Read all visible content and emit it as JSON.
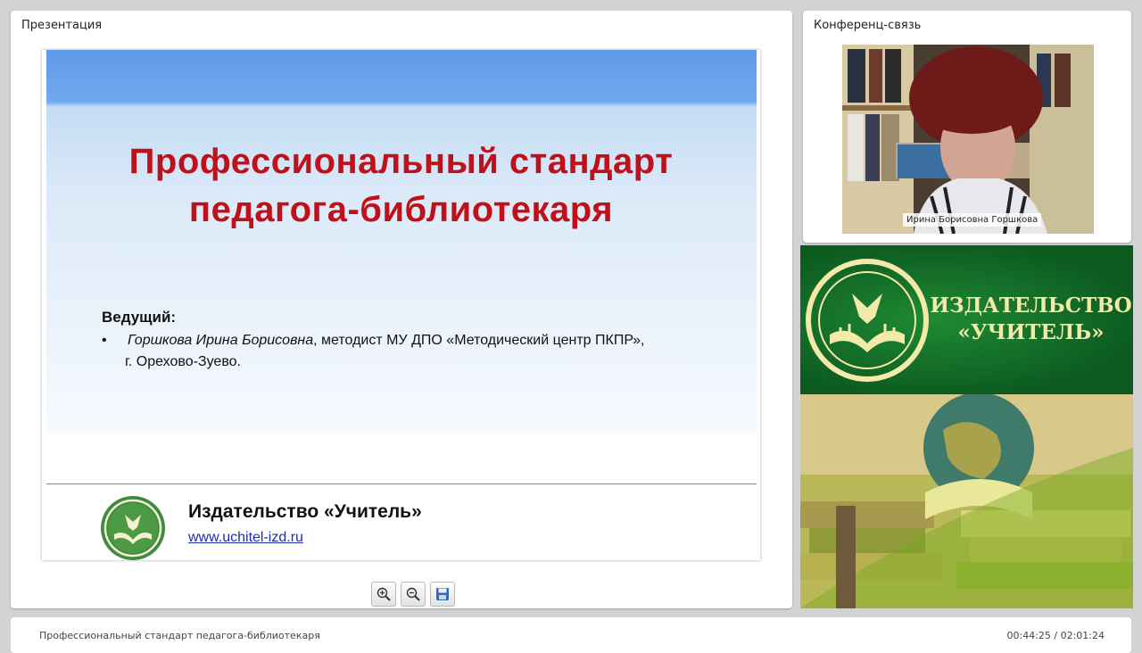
{
  "presentation_panel": {
    "title": "Презентация"
  },
  "conference_panel": {
    "title": "Конференц-связь",
    "speaker_caption": "Ирина Борисовна Горшкова"
  },
  "slide": {
    "title_line1": "Профессиональный стандарт",
    "title_line2": "педагога-библиотекаря",
    "host_label": "Ведущий:",
    "bullet": "•",
    "host_name": "Горшкова Ирина Борисовна",
    "host_desc": ", методист МУ ДПО «Методический центр ПКПР»,",
    "host_city": "г. Орехово-Зуево.",
    "publisher_name": "Издательство «Учитель»",
    "publisher_url": "www.uchitel-izd.ru"
  },
  "banner": {
    "line1": "ИЗДАТЕЛЬСТВО",
    "line2": "«УЧИТЕЛЬ»"
  },
  "toolbar": {
    "icons": [
      "zoom-in-icon",
      "zoom-out-icon",
      "save-icon"
    ]
  },
  "footer": {
    "title": "Профессиональный стандарт педагога-библиотекаря",
    "time": "00:44:25 / 02:01:24"
  },
  "colors": {
    "title_red": "#c0101a",
    "banner_green": "#0c5a20",
    "banner_text": "#f3e9a8",
    "link_blue": "#1a2fb0"
  }
}
